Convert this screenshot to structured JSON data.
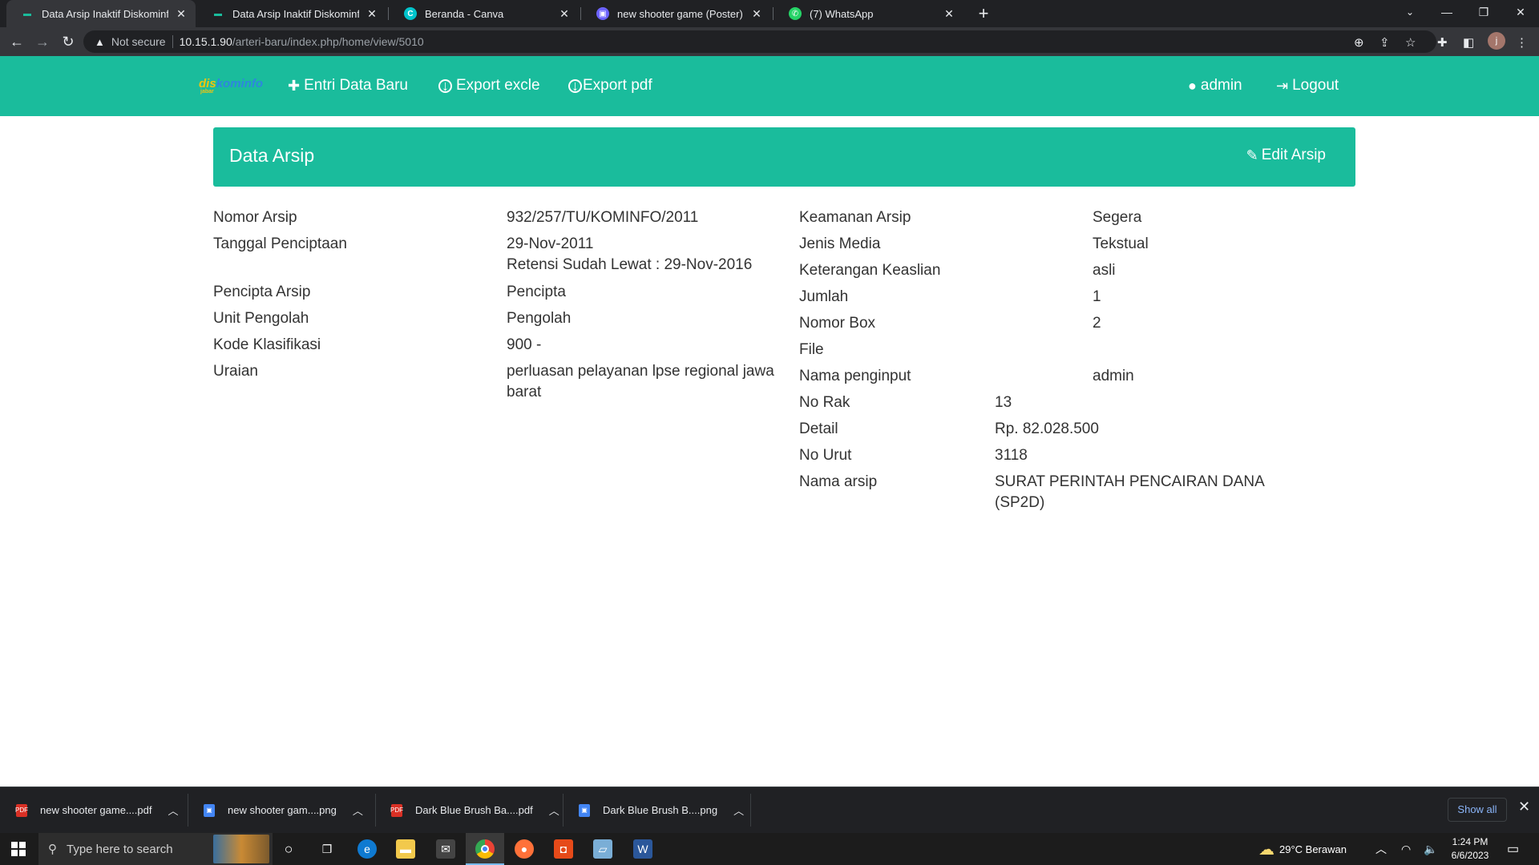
{
  "browser": {
    "tabs": [
      {
        "title": "Data Arsip Inaktif Diskominfo Jaw",
        "favicon": "diskominfo-icon"
      },
      {
        "title": "Data Arsip Inaktif Diskominfo Jaw",
        "favicon": "diskominfo-icon"
      },
      {
        "title": "Beranda - Canva",
        "favicon": "canva-icon"
      },
      {
        "title": "new shooter game (Poster) - Post",
        "favicon": "postermywall-icon"
      },
      {
        "title": "(7) WhatsApp",
        "favicon": "whatsapp-icon"
      }
    ],
    "security_label": "Not secure",
    "url_host": "10.15.1.90",
    "url_path": "/arteri-baru/index.php/home/view/5010",
    "profile_initial": "j"
  },
  "navbar": {
    "brand_part1": "dis",
    "brand_part2": "kominfo",
    "brand_sub": "jabar",
    "entri": "Entri Data Baru",
    "export_excel": "Export excle",
    "export_pdf": "Export pdf",
    "user": "admin",
    "logout": "Logout"
  },
  "panel": {
    "title": "Data Arsip",
    "edit_label": "Edit Arsip"
  },
  "left_fields": [
    {
      "label": "Nomor Arsip",
      "value": "932/257/TU/KOMINFO/2011"
    },
    {
      "label": "Tanggal Penciptaan",
      "value": "29-Nov-2011",
      "value2": "Retensi Sudah Lewat : 29-Nov-2016"
    },
    {
      "label": "Pencipta Arsip",
      "value": "Pencipta"
    },
    {
      "label": "Unit Pengolah",
      "value": "Pengolah"
    },
    {
      "label": "Kode Klasifikasi",
      "value": "900 -"
    },
    {
      "label": "Uraian",
      "value": "perluasan pelayanan lpse regional jawa",
      "value2": "barat"
    }
  ],
  "right_fields": [
    {
      "label": "Keamanan Arsip",
      "value": "Segera"
    },
    {
      "label": "Jenis Media",
      "value": "Tekstual"
    },
    {
      "label": "Keterangan Keaslian",
      "value": "asli"
    },
    {
      "label": "Jumlah",
      "value": "1"
    },
    {
      "label": "Nomor Box",
      "value": "2"
    },
    {
      "label": "File",
      "value": ""
    },
    {
      "label": "Nama penginput",
      "value": "admin"
    },
    {
      "label": "No Rak",
      "value": "13"
    },
    {
      "label": "Detail",
      "value": "Rp. 82.028.500"
    },
    {
      "label": "No Urut",
      "value": "3118"
    },
    {
      "label": "Nama arsip",
      "value": "SURAT PERINTAH PENCAIRAN DANA",
      "value2": "(SP2D)"
    }
  ],
  "downloads": {
    "items": [
      {
        "name": "new shooter game....pdf",
        "type": "pdf"
      },
      {
        "name": "new shooter gam....png",
        "type": "png"
      },
      {
        "name": "Dark Blue Brush Ba....pdf",
        "type": "pdf"
      },
      {
        "name": "Dark Blue Brush B....png",
        "type": "png"
      }
    ],
    "show_all": "Show all"
  },
  "taskbar": {
    "search_placeholder": "Type here to search",
    "weather": "29°C  Berawan",
    "time": "1:24 PM",
    "date": "6/6/2023"
  },
  "colors": {
    "accent": "#1abc9c",
    "chrome_dark": "#202124",
    "text": "#333333"
  }
}
